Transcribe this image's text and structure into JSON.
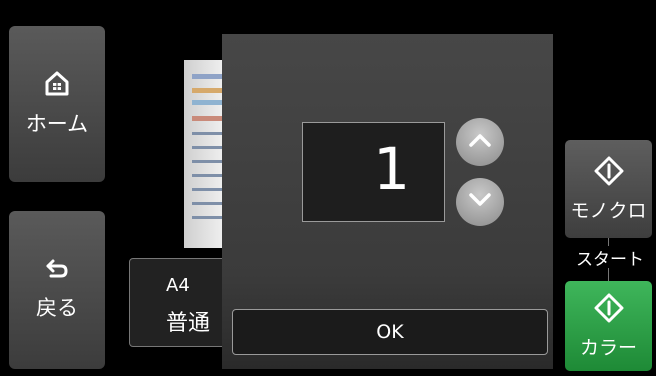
{
  "sidebar": {
    "home": {
      "label": "ホーム",
      "icon": "home-icon"
    },
    "back": {
      "label": "戻る",
      "icon": "back-arrow-icon"
    }
  },
  "background": {
    "paper_size": "A4",
    "paper_type": "普通"
  },
  "dialog": {
    "copies_value": "1",
    "ok_label": "OK"
  },
  "start": {
    "mono_label": "モノクロ",
    "section_label": "スタート",
    "color_label": "カラー",
    "color_accent": "#2aa04a"
  }
}
